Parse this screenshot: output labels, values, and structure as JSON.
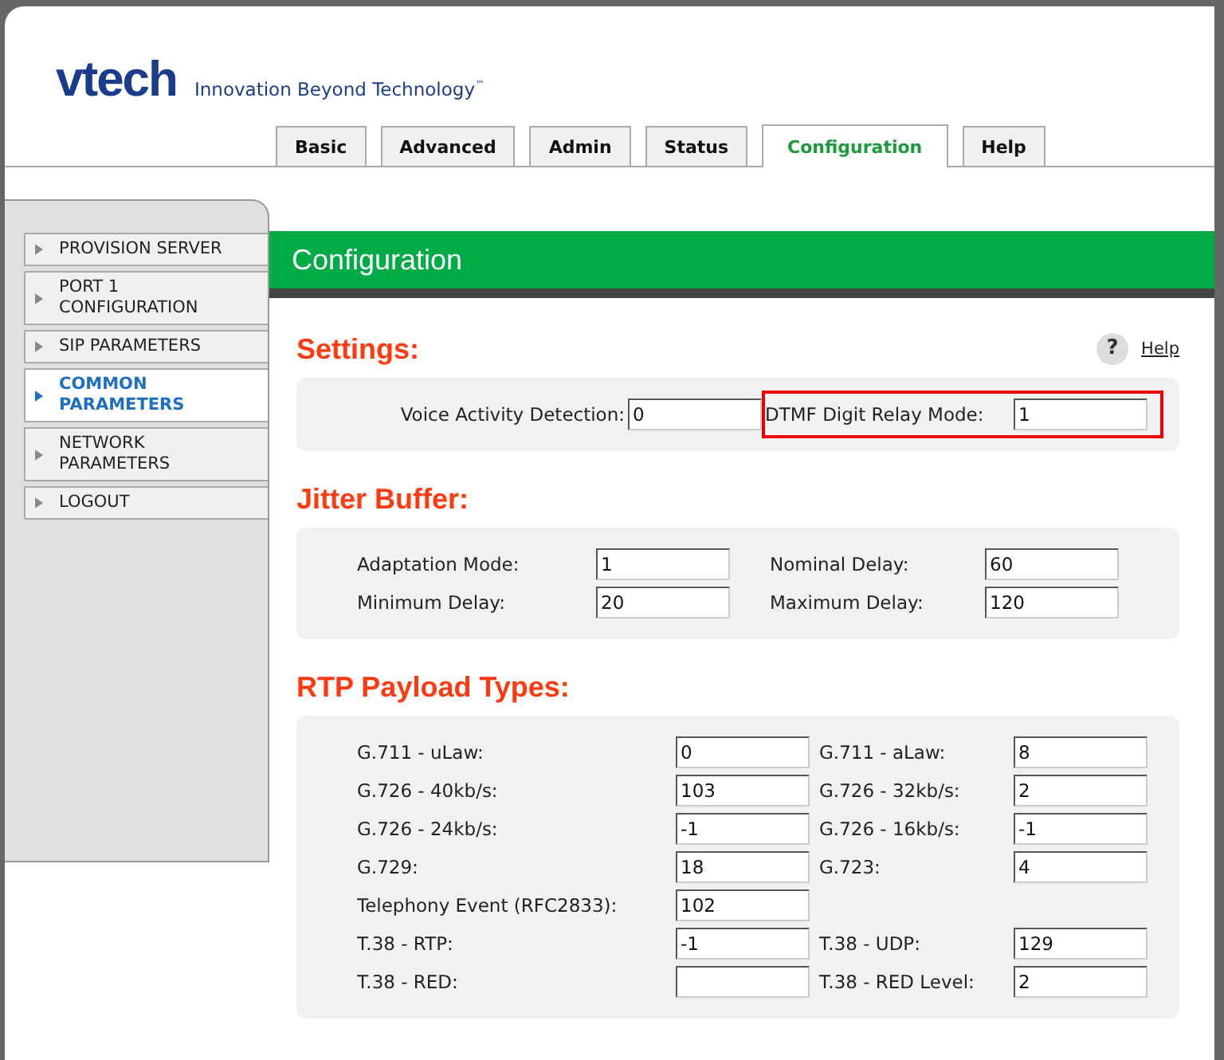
{
  "logo": {
    "brand": "vtech",
    "tagline": "Innovation Beyond Technology$^{™}$"
  },
  "tabs": [
    {
      "label": "Basic",
      "selected": false
    },
    {
      "label": "Advanced",
      "selected": false
    },
    {
      "label": "Admin",
      "selected": false
    },
    {
      "label": "Status",
      "selected": false
    },
    {
      "label": "Configuration",
      "selected": true
    },
    {
      "label": "Help",
      "selected": false
    }
  ],
  "sidebar": {
    "items": [
      {
        "label": "PROVISION SERVER",
        "selected": false
      },
      {
        "label": "PORT 1 CONFIGURATION",
        "selected": false
      },
      {
        "label": "SIP PARAMETERS",
        "selected": false
      },
      {
        "label": "COMMON PARAMETERS",
        "selected": true
      },
      {
        "label": "NETWORK PARAMETERS",
        "selected": false
      },
      {
        "label": "LOGOUT",
        "selected": false
      }
    ]
  },
  "page_title": "Configuration",
  "help": {
    "icon": "?",
    "label": "Help"
  },
  "sections": [
    {
      "title": "Settings:",
      "kind": "settings",
      "rows": [
        [
          {
            "label": "Voice Activity Detection:",
            "value": "0",
            "highlighted": false
          },
          {
            "label": "DTMF Digit Relay Mode:",
            "value": "1",
            "highlighted": true
          }
        ]
      ]
    },
    {
      "title": "Jitter Buffer:",
      "kind": "jitter",
      "rows": [
        [
          {
            "label": "Adaptation Mode:",
            "value": "1",
            "highlighted": false
          },
          {
            "label": "Nominal Delay:",
            "value": "60",
            "highlighted": false
          }
        ],
        [
          {
            "label": "Minimum Delay:",
            "value": "20",
            "highlighted": false
          },
          {
            "label": "Maximum Delay:",
            "value": "120",
            "highlighted": false
          }
        ]
      ]
    },
    {
      "title": "RTP Payload Types:",
      "kind": "rtp",
      "rows": [
        [
          {
            "label": "G.711 - uLaw:",
            "value": "0",
            "highlighted": false
          },
          {
            "label": "G.711 - aLaw:",
            "value": "8",
            "highlighted": false
          }
        ],
        [
          {
            "label": "G.726 - 40kb/s:",
            "value": "103",
            "highlighted": false
          },
          {
            "label": "G.726 - 32kb/s:",
            "value": "2",
            "highlighted": false
          }
        ],
        [
          {
            "label": "G.726 - 24kb/s:",
            "value": "-1",
            "highlighted": false
          },
          {
            "label": "G.726 - 16kb/s:",
            "value": "-1",
            "highlighted": false
          }
        ],
        [
          {
            "label": "G.729:",
            "value": "18",
            "highlighted": false
          },
          {
            "label": "G.723:",
            "value": "4",
            "highlighted": false
          }
        ],
        [
          {
            "label": "Telephony Event (RFC2833):",
            "value": "102",
            "highlighted": false
          }
        ],
        [
          {
            "label": "T.38 - RTP:",
            "value": "-1",
            "highlighted": false
          },
          {
            "label": "T.38 - UDP:",
            "value": "129",
            "highlighted": false
          }
        ],
        [
          {
            "label": "T.38 - RED:",
            "highlighted": false
          },
          {
            "label": "T.38 - RED Level:",
            "value": "2",
            "highlighted": false
          }
        ]
      ]
    }
  ]
}
